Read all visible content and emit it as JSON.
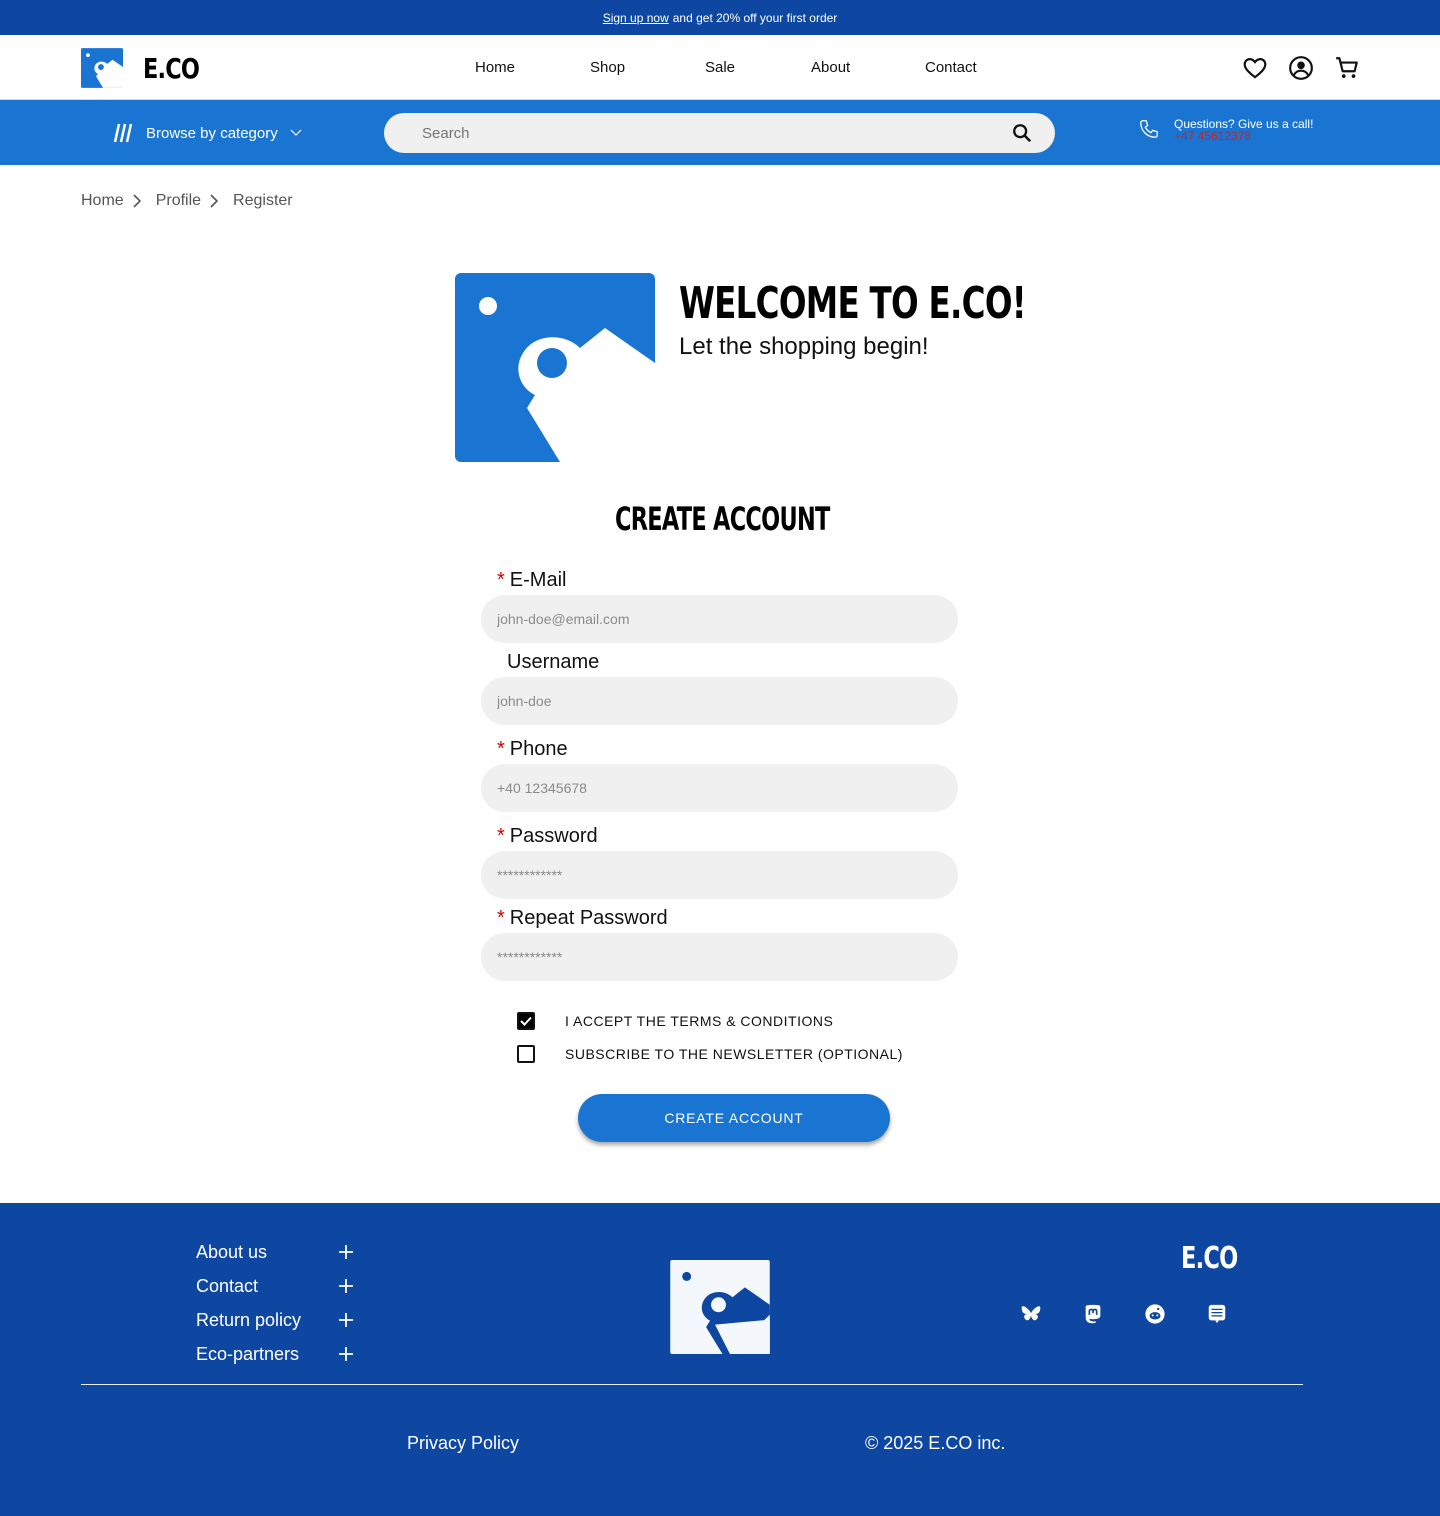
{
  "promo": {
    "link": "Sign up now",
    "text": "and get 20% off your first order"
  },
  "header": {
    "brand": "E.CO",
    "nav": [
      "Home",
      "Shop",
      "Sale",
      "About",
      "Contact"
    ],
    "icons": [
      "heart-icon",
      "account-icon",
      "cart-icon"
    ]
  },
  "subbar": {
    "browse_label": "Browse by category",
    "search_placeholder": "Search",
    "call_label": "Questions? Give us a call!",
    "call_phone": "+47 45612378"
  },
  "breadcrumb": [
    "Home",
    "Profile",
    "Register"
  ],
  "welcome": {
    "title": "WELCOME TO E.CO!",
    "subtitle": "Let the shopping begin!"
  },
  "form": {
    "title": "CREATE ACCOUNT",
    "fields": [
      {
        "label": "E-Mail",
        "required": true,
        "placeholder": "john-doe@email.com"
      },
      {
        "label": "Username",
        "required": false,
        "placeholder": "john-doe"
      },
      {
        "label": "Phone",
        "required": true,
        "placeholder": "+40 12345678"
      },
      {
        "label": "Password",
        "required": true,
        "placeholder": "************"
      },
      {
        "label": "Repeat Password",
        "required": true,
        "placeholder": "************"
      }
    ],
    "required_mark": "*",
    "checks": [
      {
        "label": "I ACCEPT THE TERMS & CONDITIONS",
        "checked": true
      },
      {
        "label": "SUBSCRIBE TO THE NEWSLETTER (OPTIONAL)",
        "checked": false
      }
    ],
    "submit": "CREATE ACCOUNT"
  },
  "footer": {
    "links": [
      "About us",
      "Contact",
      "Return policy",
      "Eco-partners"
    ],
    "brand": "E.CO",
    "social": [
      "bluesky-icon",
      "mastodon-icon",
      "reddit-icon",
      "lemmy-icon"
    ],
    "privacy": "Privacy Policy",
    "copyright": "© 2025 E.CO inc."
  },
  "colors": {
    "primary": "#1a75d2",
    "dark": "#0e47a1",
    "required": "#cc0000",
    "phone": "#d11f1f"
  }
}
